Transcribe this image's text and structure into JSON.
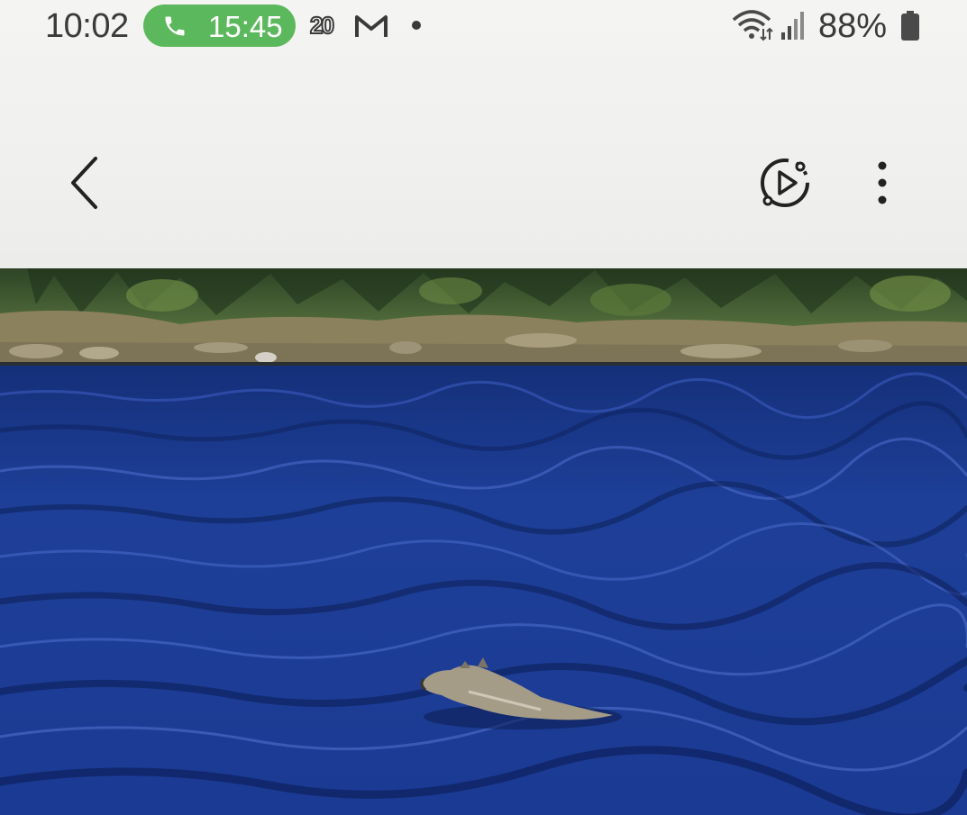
{
  "status_bar": {
    "time": "10:02",
    "call_duration": "15:45",
    "notification_badge": "20",
    "battery_percent": "88%",
    "icons": [
      "phone-icon",
      "notification-20-icon",
      "gmail-icon",
      "more-notifications-dot",
      "wifi-icon",
      "signal-icon",
      "battery-icon"
    ]
  },
  "toolbar": {
    "icons": [
      "back-arrow-icon",
      "motion-photo-play-icon",
      "more-options-icon"
    ]
  },
  "photo": {
    "subject": "animal swimming in a lake",
    "colors": {
      "water": "#1f3f9a",
      "shore": "#8e8460",
      "trees": "#3d5a30"
    }
  }
}
